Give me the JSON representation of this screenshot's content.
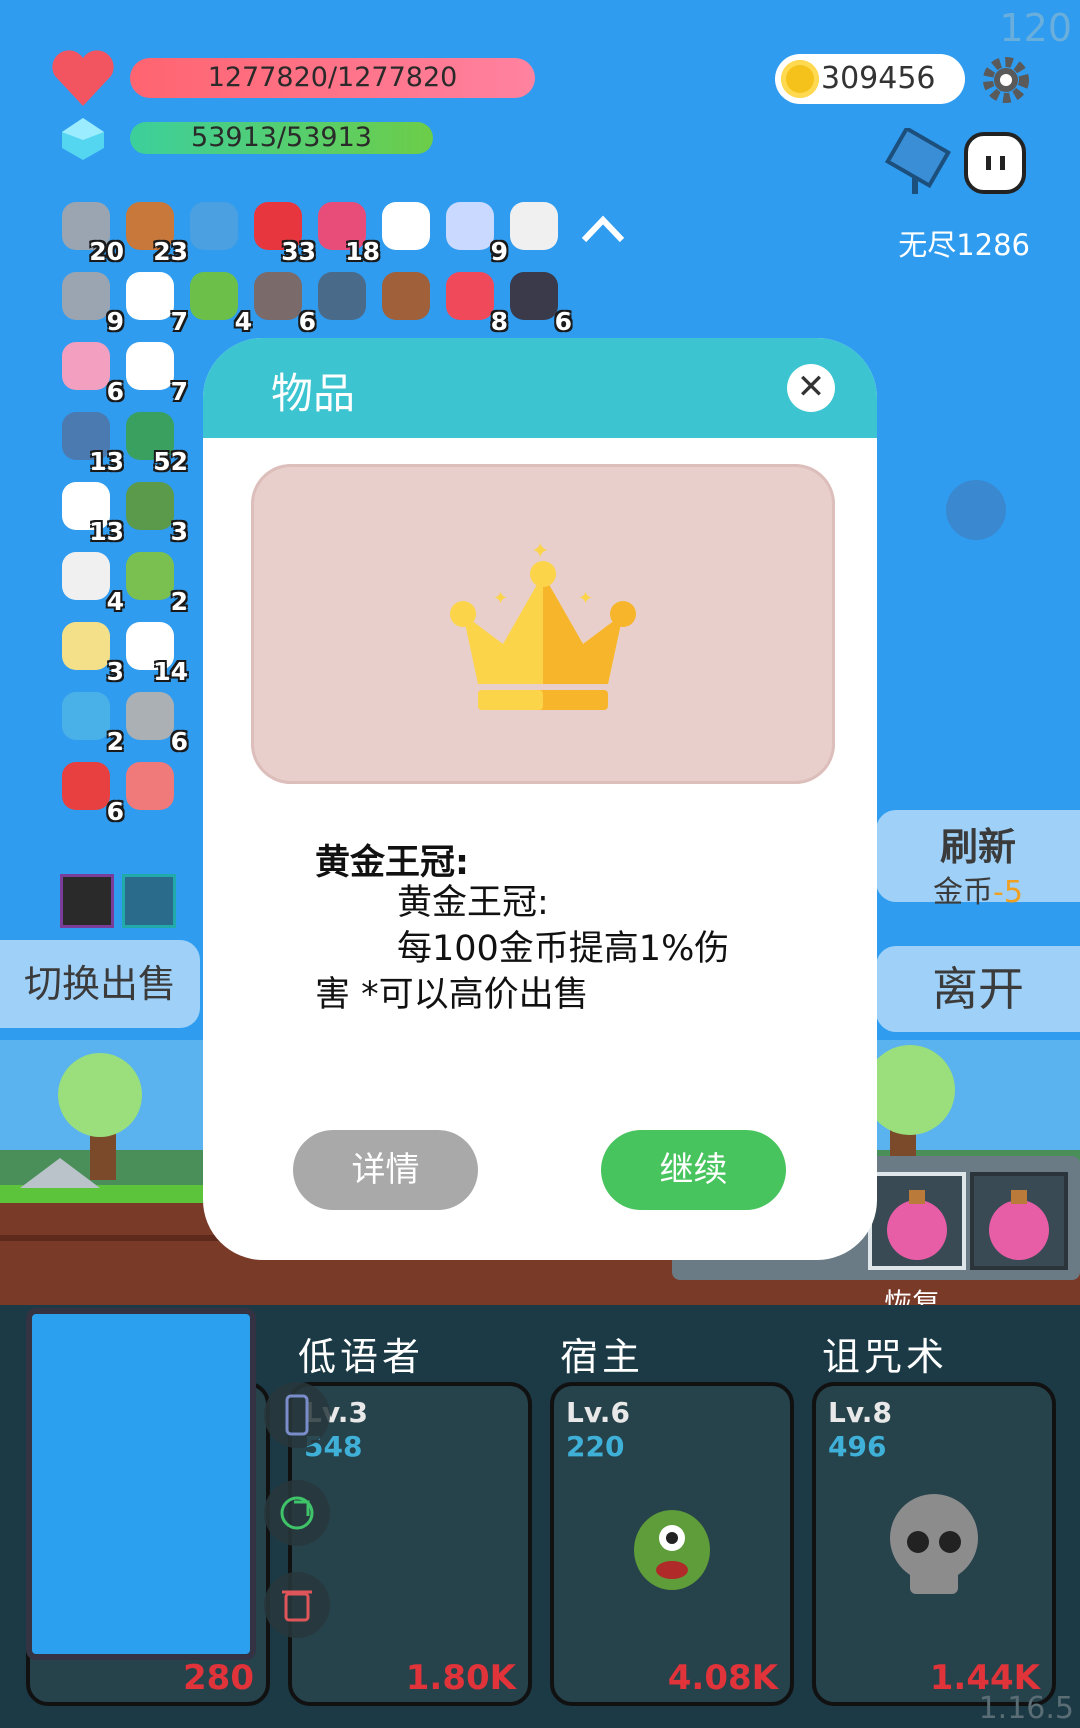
{
  "top": {
    "fps": "120",
    "hp": "1277820/1277820",
    "mp": "53913/53913",
    "coins": "309456",
    "endless_label": "无尽1286"
  },
  "items": [
    {
      "icon": "sword-icon",
      "count": "20"
    },
    {
      "icon": "shield-round-icon",
      "count": "23"
    },
    {
      "icon": "magnifier-icon",
      "count": ""
    },
    {
      "icon": "apple-icon",
      "count": "33"
    },
    {
      "icon": "jam-jar-icon",
      "count": "18"
    },
    {
      "icon": "wing-icon",
      "count": ""
    },
    {
      "icon": "pill-icon",
      "count": "9"
    },
    {
      "icon": "hook-icon",
      "count": ""
    },
    {
      "icon": "axe-icon",
      "count": "9"
    },
    {
      "icon": "playing-card-icon",
      "count": "7"
    },
    {
      "icon": "zombie-icon",
      "count": "4"
    },
    {
      "icon": "tombstone-icon",
      "count": "6"
    },
    {
      "icon": "mortar-icon",
      "count": ""
    },
    {
      "icon": "treasure-chest-icon",
      "count": ""
    },
    {
      "icon": "heart-icon",
      "count": "8"
    },
    {
      "icon": "bat-icon",
      "count": "6"
    },
    {
      "icon": "spray-bottle-icon",
      "count": "6"
    },
    {
      "icon": "clipboard-icon",
      "count": "7"
    },
    {
      "icon": "shield-icon",
      "count": "13"
    },
    {
      "icon": "money-heart-icon",
      "count": "52"
    },
    {
      "icon": "flower-icon",
      "count": "13"
    },
    {
      "icon": "grenade-icon",
      "count": "3"
    },
    {
      "icon": "cloud-icon",
      "count": "4"
    },
    {
      "icon": "lime-icon",
      "count": "2"
    },
    {
      "icon": "map-pencil-icon",
      "count": "3"
    },
    {
      "icon": "egg-icon",
      "count": "14"
    },
    {
      "icon": "chat-bubble-icon",
      "count": "2"
    },
    {
      "icon": "spiked-mace-icon",
      "count": "6"
    },
    {
      "icon": "gift-icon",
      "count": "6"
    },
    {
      "icon": "steak-icon",
      "count": ""
    }
  ],
  "side": {
    "switch_sell": "切换出售",
    "refresh": "刷新",
    "refresh_cost_label": "金币",
    "refresh_cost_value": "-5",
    "leave": "离开",
    "restore": "恢复"
  },
  "modal": {
    "title": "物品",
    "item_name": "黄金王冠:",
    "desc_line1": "黄金王冠:",
    "desc_line2": "每100金币提高1%伤",
    "desc_line3": "害 *可以高价出售",
    "detail_button": "详情",
    "continue_button": "继续"
  },
  "skills": [
    {
      "title": "",
      "level": "",
      "value": "",
      "damage": "280"
    },
    {
      "title": "低语者",
      "level": "Lv.3",
      "value": "548",
      "damage": "1.80K"
    },
    {
      "title": "宿主",
      "level": "Lv.6",
      "value": "220",
      "damage": "4.08K"
    },
    {
      "title": "诅咒术",
      "level": "Lv.8",
      "value": "496",
      "damage": "1.44K"
    }
  ],
  "version": "1.16.5",
  "colors": {
    "modal_header": "#3cc4d1",
    "continue": "#47c45d",
    "coin_cost": "#f0a020"
  }
}
